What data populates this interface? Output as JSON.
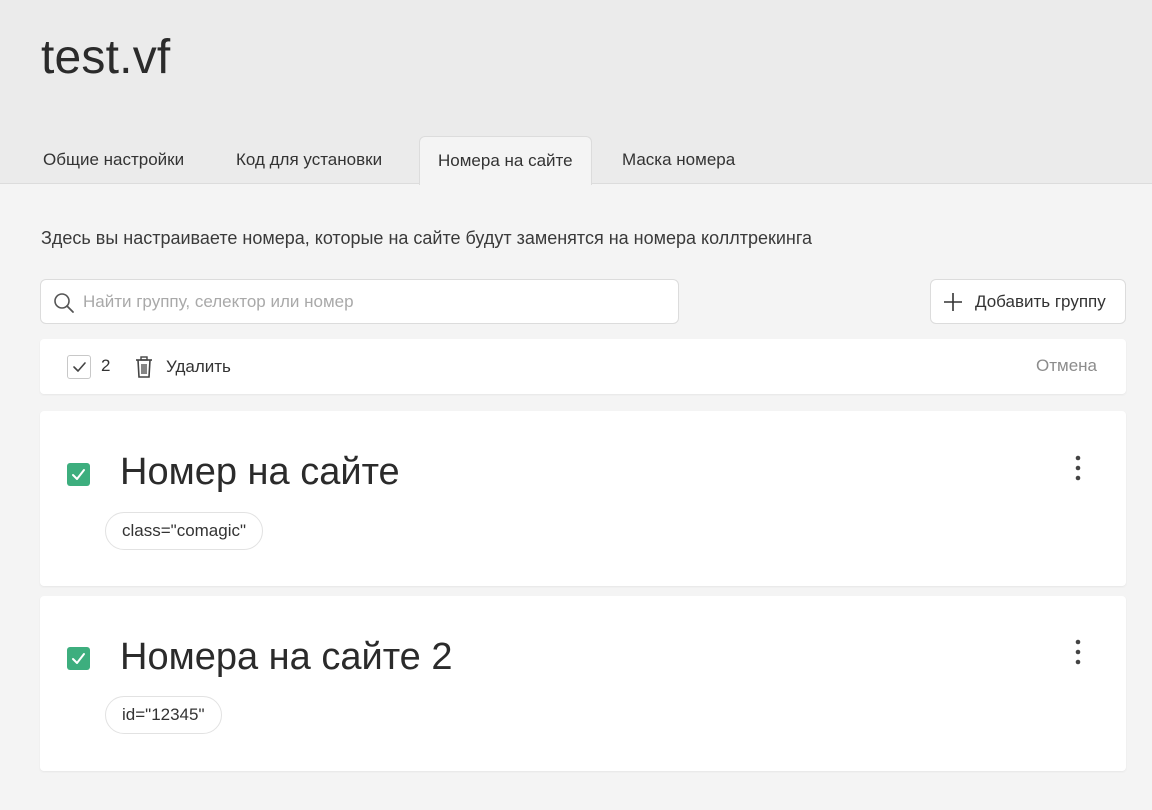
{
  "app": {
    "title": "test.vf"
  },
  "tabs": [
    {
      "label": "Общие настройки"
    },
    {
      "label": "Код для установки"
    },
    {
      "label": "Номера на сайте"
    },
    {
      "label": "Маска номера"
    }
  ],
  "active_tab": "Номера на сайте",
  "description": "Здесь вы настраиваете номера, которые на сайте будут заменятся на номера коллтрекинга",
  "search": {
    "placeholder": "Найти группу, селектор или номер",
    "value": ""
  },
  "add_group_label": "Добавить группу",
  "bulk_actions": {
    "selected_count": "2",
    "delete_label": "Удалить",
    "cancel_label": "Отмена"
  },
  "groups": [
    {
      "title": "Номер на сайте",
      "selector": "class=\"comagic\"",
      "checked": true
    },
    {
      "title": "Номера на сайте 2",
      "selector": "id=\"12345\"",
      "checked": true
    }
  ],
  "colors": {
    "accent_green": "#3dae7e",
    "header_bg": "#ebebeb",
    "page_bg": "#f4f4f4"
  },
  "icons": {
    "search": "search-icon",
    "add": "plus-icon",
    "check": "check-icon",
    "delete": "trash-icon",
    "menu": "more-vertical-icon"
  }
}
